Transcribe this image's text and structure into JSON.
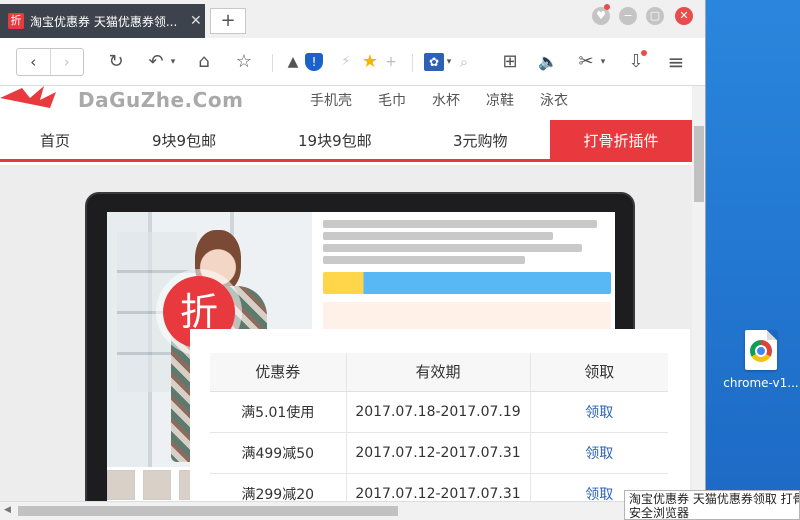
{
  "tab": {
    "favicon": "折",
    "title": "淘宝优惠券 天猫优惠券领...",
    "close": "✕",
    "new_tab": "+"
  },
  "window_controls": {
    "skin": "♥",
    "minimize": "−",
    "maximize": "▢",
    "close": "✕"
  },
  "toolbar": {
    "back": "‹",
    "forward": "›",
    "reload": "↻",
    "undo": "↶",
    "home": "⌂",
    "bookmark": "☆",
    "rocket": "▲",
    "shield": "!",
    "flash": "⚡",
    "star": "★",
    "plus": "+",
    "paw": "✿",
    "search": "⌕",
    "apps": "⊞",
    "sound": "🔈",
    "cut": "✂",
    "download": "⇩",
    "menu": "≡"
  },
  "site": {
    "logo_text": "DaGuZhe.Com",
    "top_links": [
      "手机壳",
      "毛巾",
      "水杯",
      "凉鞋",
      "泳衣"
    ],
    "nav": [
      {
        "label": "首页"
      },
      {
        "label": "9块9包邮"
      },
      {
        "label": "19块9包邮"
      },
      {
        "label": "3元购物"
      },
      {
        "label": "打骨折插件"
      }
    ]
  },
  "badge": {
    "char": "折"
  },
  "coupons": {
    "headers": [
      "优惠券",
      "有效期",
      "领取"
    ],
    "rows": [
      {
        "coupon": "满5.01使用",
        "period": "2017.07.18-2017.07.19",
        "action": "领取"
      },
      {
        "coupon": "满499减50",
        "period": "2017.07.12-2017.07.31",
        "action": "领取"
      },
      {
        "coupon": "满299减20",
        "period": "2017.07.12-2017.07.31",
        "action": "领取"
      }
    ]
  },
  "status_tooltip": {
    "line1": "淘宝优惠券 天猫优惠券领取 打骨",
    "line2": "安全浏览器"
  },
  "desktop": {
    "icon_label": "chrome-v1..."
  }
}
